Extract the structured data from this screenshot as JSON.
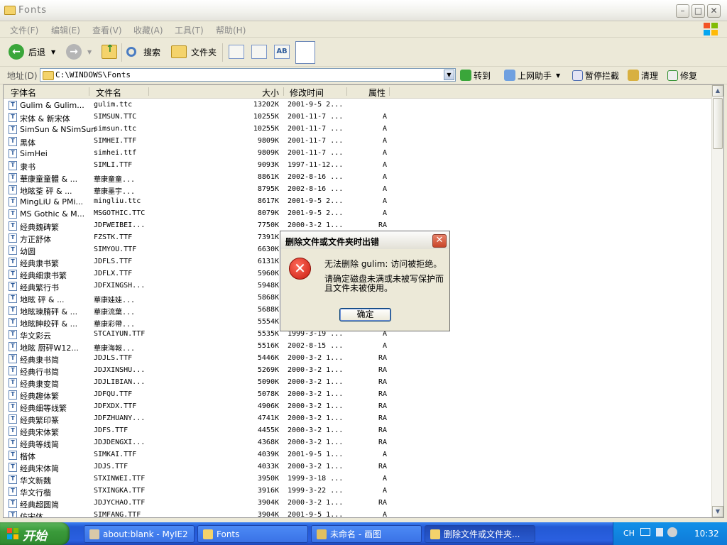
{
  "window": {
    "title": "Fonts",
    "menu": [
      "文件(F)",
      "编辑(E)",
      "查看(V)",
      "收藏(A)",
      "工具(T)",
      "帮助(H)"
    ],
    "toolbar": {
      "back": "后退",
      "search": "搜索",
      "folders": "文件夹"
    },
    "address": {
      "label": "地址(D)",
      "value": "C:\\WINDOWS\\Fonts",
      "go": "转到",
      "assistant": "上网助手",
      "popup_block": "暂停拦截",
      "clean": "清理",
      "repair": "修复"
    }
  },
  "list": {
    "columns": [
      "字体名",
      "文件名",
      "大小",
      "修改时间",
      "属性"
    ],
    "rows": [
      [
        "Gulim & Gulim...",
        "gulim.ttc",
        "13202K",
        "2001-9-5 2...",
        ""
      ],
      [
        "宋体 & 新宋体",
        "SIMSUN.TTC",
        "10255K",
        "2001-11-7 ...",
        "A"
      ],
      [
        "SimSun & NSimSun",
        "simsun.ttc",
        "10255K",
        "2001-11-7 ...",
        "A"
      ],
      [
        "黑体",
        "SIMHEI.TTF",
        "9809K",
        "2001-11-7 ...",
        "A"
      ],
      [
        "SimHei",
        "simhei.ttf",
        "9809K",
        "2001-11-7 ...",
        "A"
      ],
      [
        "隶书",
        "SIMLI.TTF",
        "9093K",
        "1997-11-12...",
        "A"
      ],
      [
        "華康童童體 & ...",
        "華康童童...",
        "8861K",
        "2002-8-16 ...",
        "A"
      ],
      [
        "地眩荃  砰 & ...",
        "華康墨宇...",
        "8795K",
        "2002-8-16 ...",
        "A"
      ],
      [
        "MingLiU & PMi...",
        "mingliu.ttc",
        "8617K",
        "2001-9-5 2...",
        "A"
      ],
      [
        "MS Gothic & M...",
        "MSGOTHIC.TTC",
        "8079K",
        "2001-9-5 2...",
        "A"
      ],
      [
        "经典魏碑繁",
        "JDFWEIBEI...",
        "7750K",
        "2000-3-2 1...",
        "RA"
      ],
      [
        "方正舒体",
        "FZSTK.TTF",
        "7391K",
        "",
        ""
      ],
      [
        "幼圆",
        "SIMYOU.TTF",
        "6630K",
        "",
        ""
      ],
      [
        "经典隶书繁",
        "JDFLS.TTF",
        "6131K",
        "",
        ""
      ],
      [
        "经典细隶书繁",
        "JDFLX.TTF",
        "5960K",
        "",
        ""
      ],
      [
        "经典繁行书",
        "JDFXINGSH...",
        "5948K",
        "",
        ""
      ],
      [
        "地眩   砰 & ...",
        "華康娃娃...",
        "5868K",
        "",
        ""
      ],
      [
        "地眩瑓膌砰 & ...",
        "華康流葉...",
        "5688K",
        "",
        ""
      ],
      [
        "地眩眒皎砰 & ...",
        "華康彩帶...",
        "5554K",
        "",
        ""
      ],
      [
        "华文彩云",
        "STCAIYUN.TTF",
        "5535K",
        "1999-3-19 ...",
        "A"
      ],
      [
        "地眩  厨砰W12...",
        "華康海報...",
        "5516K",
        "2002-8-15 ...",
        "A"
      ],
      [
        "经典隶书简",
        "JDJLS.TTF",
        "5446K",
        "2000-3-2 1...",
        "RA"
      ],
      [
        "经典行书简",
        "JDJXINSHU...",
        "5269K",
        "2000-3-2 1...",
        "RA"
      ],
      [
        "经典隶变简",
        "JDJLIBIAN...",
        "5090K",
        "2000-3-2 1...",
        "RA"
      ],
      [
        "经典趣体繁",
        "JDFQU.TTF",
        "5078K",
        "2000-3-2 1...",
        "RA"
      ],
      [
        "经典细等线繁",
        "JDFXDX.TTF",
        "4906K",
        "2000-3-2 1...",
        "RA"
      ],
      [
        "经典繁印篆",
        "JDFZHUANY...",
        "4741K",
        "2000-3-2 1...",
        "RA"
      ],
      [
        "经典宋体繁",
        "JDFS.TTF",
        "4455K",
        "2000-3-2 1...",
        "RA"
      ],
      [
        "经典等线简",
        "JDJDENGXI...",
        "4368K",
        "2000-3-2 1...",
        "RA"
      ],
      [
        "楷体",
        "SIMKAI.TTF",
        "4039K",
        "2001-9-5 1...",
        "A"
      ],
      [
        "经典宋体简",
        "JDJS.TTF",
        "4033K",
        "2000-3-2 1...",
        "RA"
      ],
      [
        "华文新魏",
        "STXINWEI.TTF",
        "3950K",
        "1999-3-18 ...",
        "A"
      ],
      [
        "华文行楷",
        "STXINGKA.TTF",
        "3916K",
        "1999-3-22 ...",
        "A"
      ],
      [
        "经典超圆简",
        "JDJYCHAO.TTF",
        "3904K",
        "2000-3-2 1...",
        "RA"
      ],
      [
        "仿宋体",
        "SIMFANG.TTF",
        "3904K",
        "2001-9-5 1...",
        "A"
      ]
    ]
  },
  "dialog": {
    "title": "删除文件或文件夹时出错",
    "message": "无法删除 gulim: 访问被拒绝。",
    "detail": "请确定磁盘未满或未被写保护而且文件未被使用。",
    "ok": "确定"
  },
  "taskbar": {
    "start": "开始",
    "tasks": [
      "about:blank - MyIE2",
      "Fonts",
      "未命名 - 画图",
      "删除文件或文件夹..."
    ],
    "lang": "CH",
    "clock": "10:32"
  }
}
